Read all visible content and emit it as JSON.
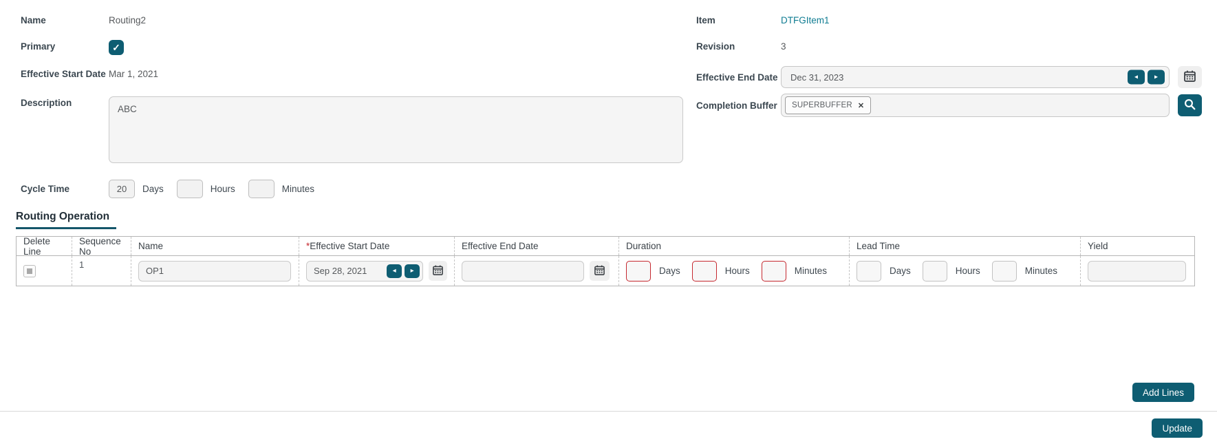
{
  "colors": {
    "accent_teal": "#0e5d72",
    "link_teal": "#0f7c92",
    "danger_red": "#c5282f"
  },
  "icons": {
    "check": "✓",
    "close": "✕",
    "arrow_left": "◂",
    "arrow_right": "▸"
  },
  "fields": {
    "name": {
      "label": "Name",
      "value": "Routing2"
    },
    "primary": {
      "label": "Primary",
      "checked": true
    },
    "effective_start_date": {
      "label": "Effective Start Date",
      "value": "Mar 1, 2021"
    },
    "description": {
      "label": "Description",
      "value": "ABC"
    },
    "cycle_time": {
      "label": "Cycle Time",
      "days": "20",
      "hours": "",
      "minutes": "",
      "days_label": "Days",
      "hours_label": "Hours",
      "minutes_label": "Minutes"
    },
    "item": {
      "label": "Item",
      "value": "DTFGItem1"
    },
    "revision": {
      "label": "Revision",
      "value": "3"
    },
    "effective_end_date": {
      "label": "Effective End Date",
      "value": "Dec 31, 2023"
    },
    "completion_buffer": {
      "label": "Completion Buffer",
      "chip": "SUPERBUFFER"
    }
  },
  "routing_operation": {
    "title": "Routing Operation",
    "required_marker": "*",
    "columns": [
      "Delete Line",
      "Sequence No",
      "Name",
      "Effective Start Date",
      "Effective End Date",
      "Duration",
      "Lead Time",
      "Yield"
    ],
    "row": {
      "sequence_no": "1",
      "name": "OP1",
      "effective_start_date": "Sep 28, 2021",
      "effective_end_date": "",
      "duration": {
        "days": "",
        "hours": "",
        "minutes": ""
      },
      "lead_time": {
        "days": "",
        "hours": "",
        "minutes": ""
      },
      "yield": "",
      "unit_labels": {
        "days": "Days",
        "hours": "Hours",
        "minutes": "Minutes"
      }
    }
  },
  "actions": {
    "add_lines_label": "Add Lines",
    "update_label": "Update"
  }
}
